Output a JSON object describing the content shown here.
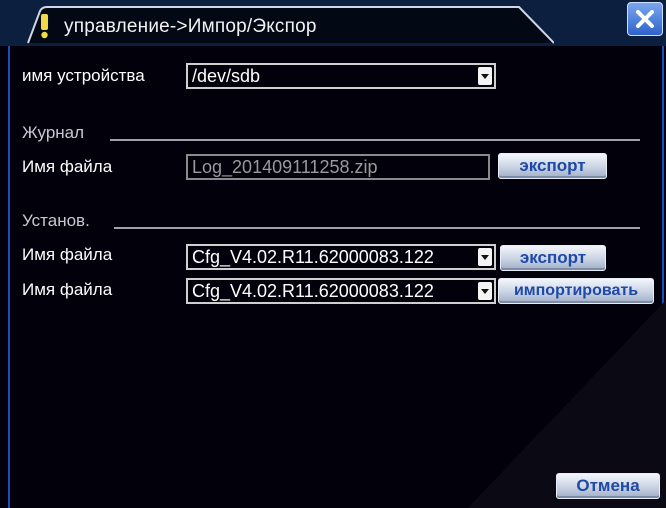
{
  "window": {
    "title": "управление->Импор/Экспор",
    "title_icon": "exclamation-icon",
    "close_icon": "close-icon",
    "colors": {
      "background": "#02000a",
      "title_bar": "#0d1f3e",
      "accent": "#1d4fb8",
      "button_text": "#1e49a8"
    }
  },
  "device": {
    "label": "имя устройства",
    "value": "/dev/sdb"
  },
  "log_section": {
    "heading": "Журнал",
    "file_label": "Имя файла",
    "file_value": "Log_201409111258.zip",
    "export_label": "экспорт"
  },
  "settings_section": {
    "heading": "Установ.",
    "export_file_label": "Имя файла",
    "export_file_value": "Cfg_V4.02.R11.62000083.122",
    "export_label": "экспорт",
    "import_file_label": "Имя файла",
    "import_file_value": "Cfg_V4.02.R11.62000083.122",
    "import_label": "импортировать"
  },
  "footer": {
    "cancel_label": "Отмена"
  }
}
